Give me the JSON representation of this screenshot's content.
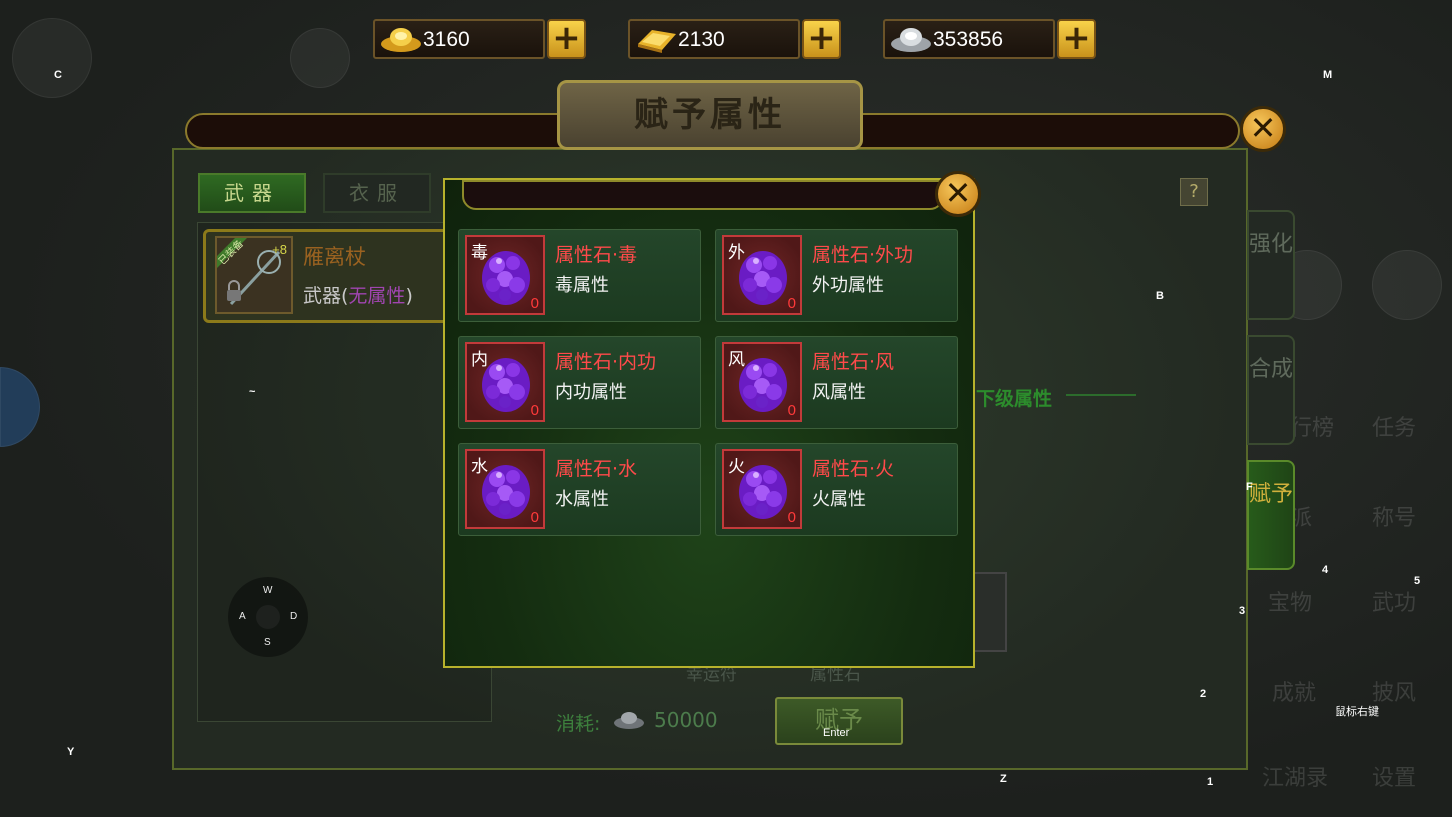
{
  "currencies": [
    {
      "icon": "gold-ingot-icon",
      "value": "3160"
    },
    {
      "icon": "gold-bar-icon",
      "value": "2130"
    },
    {
      "icon": "silver-ingot-icon",
      "value": "353856"
    }
  ],
  "plus_label": "+",
  "dialog": {
    "title": "赋予属性",
    "close_label": "✕",
    "tabs": [
      "武器",
      "衣服"
    ],
    "help_label": "?",
    "item": {
      "tag": "已装备",
      "level": "+8",
      "name": "雁离杖",
      "type_prefix": "武器(",
      "attribute": "无属性",
      "type_suffix": ")"
    },
    "side_tabs": [
      {
        "label": "强化"
      },
      {
        "label": "合成"
      },
      {
        "label": "赋予"
      }
    ],
    "behind_label": "下级属性",
    "slot_labels": [
      "幸运符",
      "属性石"
    ],
    "cost_label": "消耗:",
    "cost_value": "50000",
    "assign_button": "赋予"
  },
  "popup": {
    "close_label": "✕",
    "stones": [
      {
        "tag": "毒",
        "count": "0",
        "name": "属性石·毒",
        "desc": "毒属性"
      },
      {
        "tag": "外",
        "count": "0",
        "name": "属性石·外功",
        "desc": "外功属性"
      },
      {
        "tag": "内",
        "count": "0",
        "name": "属性石·内功",
        "desc": "内功属性"
      },
      {
        "tag": "风",
        "count": "0",
        "name": "属性石·风",
        "desc": "风属性"
      },
      {
        "tag": "水",
        "count": "0",
        "name": "属性石·水",
        "desc": "水属性"
      },
      {
        "tag": "火",
        "count": "0",
        "name": "属性石·火",
        "desc": "火属性"
      }
    ]
  },
  "key_hints": {
    "c": "C",
    "m": "M",
    "b": "B",
    "f": "F",
    "tilde": "~",
    "n4": "4",
    "n5": "5",
    "n3": "3",
    "n2": "2",
    "n1": "1",
    "y": "Y",
    "z": "Z",
    "enter": "Enter",
    "right_mouse": "鼠标右键",
    "w": "W",
    "a": "A",
    "s": "S",
    "d": "D"
  },
  "background": {
    "menu_labels": [
      "排行榜",
      "任务",
      "门派",
      "称号",
      "宝物",
      "武功",
      "成就",
      "披风",
      "江湖录",
      "设置"
    ]
  },
  "colors": {
    "stone_name": "#ff4a4a",
    "attribute_purple": "#a045b0",
    "popup_border": "#b7b22c"
  }
}
